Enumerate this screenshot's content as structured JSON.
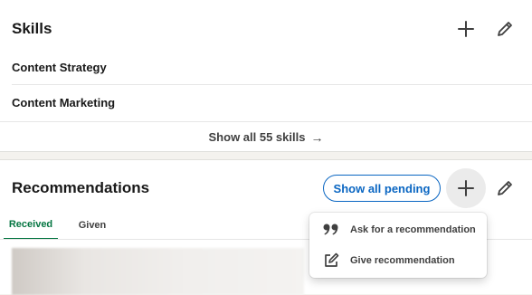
{
  "skills": {
    "title": "Skills",
    "add_icon": "plus-icon",
    "edit_icon": "pencil-icon",
    "items": [
      {
        "label": "Content Strategy"
      },
      {
        "label": "Content Marketing"
      }
    ],
    "show_all_label": "Show all 55 skills",
    "show_all_arrow": "→"
  },
  "recommendations": {
    "title": "Recommendations",
    "pending_button": "Show all pending",
    "add_icon": "plus-icon",
    "edit_icon": "pencil-icon",
    "tabs": [
      {
        "label": "Received",
        "active": true
      },
      {
        "label": "Given",
        "active": false
      }
    ]
  },
  "dropdown": {
    "items": [
      {
        "label": "Ask for a recommendation",
        "icon": "quote-icon"
      },
      {
        "label": "Give recommendation",
        "icon": "edit-square-icon"
      }
    ]
  },
  "colors": {
    "accent_blue": "#0a66c2",
    "active_tab_green": "#057642",
    "page_background": "#f4f2ee"
  }
}
